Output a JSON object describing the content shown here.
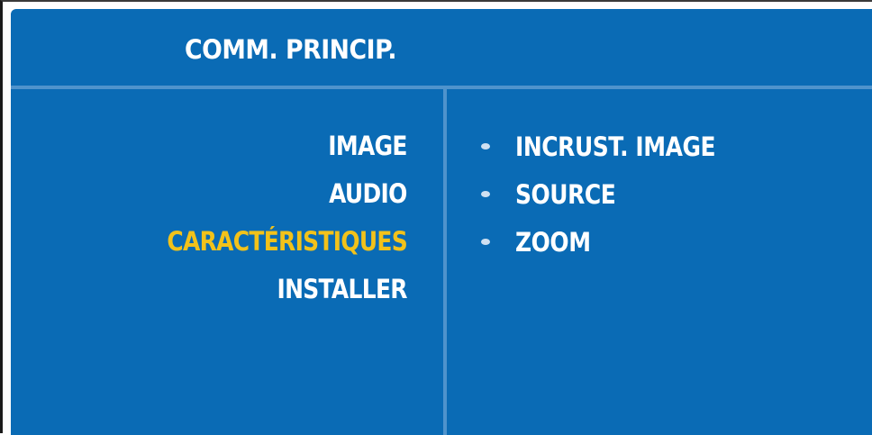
{
  "header": {
    "title": "COMM. PRINCIP."
  },
  "main_menu": {
    "items": [
      {
        "label": "IMAGE",
        "selected": false
      },
      {
        "label": "AUDIO",
        "selected": false
      },
      {
        "label": "CARACTÉRISTIQUES",
        "selected": true
      },
      {
        "label": "INSTALLER",
        "selected": false
      }
    ]
  },
  "submenu": {
    "items": [
      {
        "label": "INCRUST. IMAGE",
        "icon": "bullet-icon"
      },
      {
        "label": "SOURCE",
        "icon": "bullet-icon"
      },
      {
        "label": "ZOOM",
        "icon": "bullet-icon"
      }
    ]
  },
  "colors": {
    "panel_background": "#0a6bb5",
    "divider": "#4f93cc",
    "text": "#ffffff",
    "selected_text": "#f2c21a"
  }
}
